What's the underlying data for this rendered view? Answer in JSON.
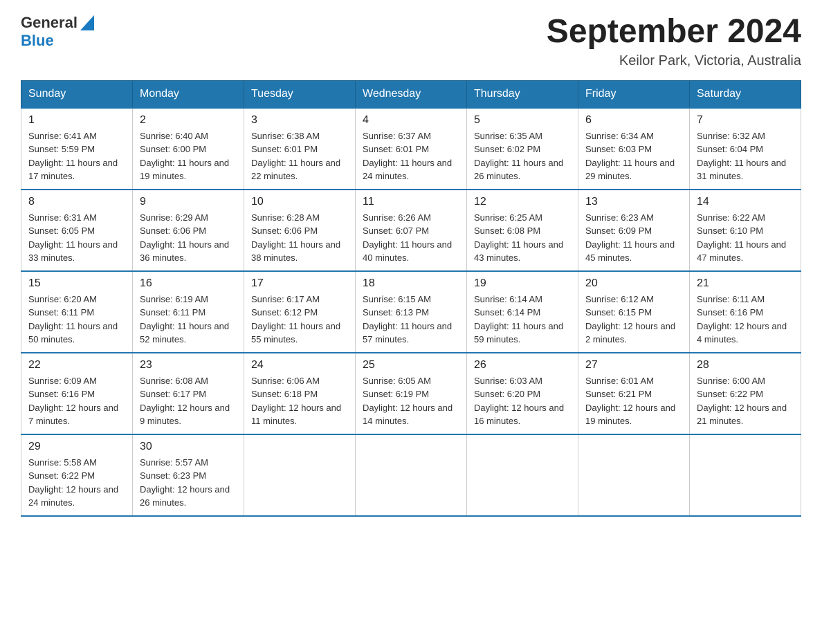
{
  "logo": {
    "text_general": "General",
    "text_blue": "Blue",
    "triangle": "▶"
  },
  "title": "September 2024",
  "subtitle": "Keilor Park, Victoria, Australia",
  "days_of_week": [
    "Sunday",
    "Monday",
    "Tuesday",
    "Wednesday",
    "Thursday",
    "Friday",
    "Saturday"
  ],
  "weeks": [
    [
      {
        "day": "1",
        "sunrise": "6:41 AM",
        "sunset": "5:59 PM",
        "daylight": "11 hours and 17 minutes."
      },
      {
        "day": "2",
        "sunrise": "6:40 AM",
        "sunset": "6:00 PM",
        "daylight": "11 hours and 19 minutes."
      },
      {
        "day": "3",
        "sunrise": "6:38 AM",
        "sunset": "6:01 PM",
        "daylight": "11 hours and 22 minutes."
      },
      {
        "day": "4",
        "sunrise": "6:37 AM",
        "sunset": "6:01 PM",
        "daylight": "11 hours and 24 minutes."
      },
      {
        "day": "5",
        "sunrise": "6:35 AM",
        "sunset": "6:02 PM",
        "daylight": "11 hours and 26 minutes."
      },
      {
        "day": "6",
        "sunrise": "6:34 AM",
        "sunset": "6:03 PM",
        "daylight": "11 hours and 29 minutes."
      },
      {
        "day": "7",
        "sunrise": "6:32 AM",
        "sunset": "6:04 PM",
        "daylight": "11 hours and 31 minutes."
      }
    ],
    [
      {
        "day": "8",
        "sunrise": "6:31 AM",
        "sunset": "6:05 PM",
        "daylight": "11 hours and 33 minutes."
      },
      {
        "day": "9",
        "sunrise": "6:29 AM",
        "sunset": "6:06 PM",
        "daylight": "11 hours and 36 minutes."
      },
      {
        "day": "10",
        "sunrise": "6:28 AM",
        "sunset": "6:06 PM",
        "daylight": "11 hours and 38 minutes."
      },
      {
        "day": "11",
        "sunrise": "6:26 AM",
        "sunset": "6:07 PM",
        "daylight": "11 hours and 40 minutes."
      },
      {
        "day": "12",
        "sunrise": "6:25 AM",
        "sunset": "6:08 PM",
        "daylight": "11 hours and 43 minutes."
      },
      {
        "day": "13",
        "sunrise": "6:23 AM",
        "sunset": "6:09 PM",
        "daylight": "11 hours and 45 minutes."
      },
      {
        "day": "14",
        "sunrise": "6:22 AM",
        "sunset": "6:10 PM",
        "daylight": "11 hours and 47 minutes."
      }
    ],
    [
      {
        "day": "15",
        "sunrise": "6:20 AM",
        "sunset": "6:11 PM",
        "daylight": "11 hours and 50 minutes."
      },
      {
        "day": "16",
        "sunrise": "6:19 AM",
        "sunset": "6:11 PM",
        "daylight": "11 hours and 52 minutes."
      },
      {
        "day": "17",
        "sunrise": "6:17 AM",
        "sunset": "6:12 PM",
        "daylight": "11 hours and 55 minutes."
      },
      {
        "day": "18",
        "sunrise": "6:15 AM",
        "sunset": "6:13 PM",
        "daylight": "11 hours and 57 minutes."
      },
      {
        "day": "19",
        "sunrise": "6:14 AM",
        "sunset": "6:14 PM",
        "daylight": "11 hours and 59 minutes."
      },
      {
        "day": "20",
        "sunrise": "6:12 AM",
        "sunset": "6:15 PM",
        "daylight": "12 hours and 2 minutes."
      },
      {
        "day": "21",
        "sunrise": "6:11 AM",
        "sunset": "6:16 PM",
        "daylight": "12 hours and 4 minutes."
      }
    ],
    [
      {
        "day": "22",
        "sunrise": "6:09 AM",
        "sunset": "6:16 PM",
        "daylight": "12 hours and 7 minutes."
      },
      {
        "day": "23",
        "sunrise": "6:08 AM",
        "sunset": "6:17 PM",
        "daylight": "12 hours and 9 minutes."
      },
      {
        "day": "24",
        "sunrise": "6:06 AM",
        "sunset": "6:18 PM",
        "daylight": "12 hours and 11 minutes."
      },
      {
        "day": "25",
        "sunrise": "6:05 AM",
        "sunset": "6:19 PM",
        "daylight": "12 hours and 14 minutes."
      },
      {
        "day": "26",
        "sunrise": "6:03 AM",
        "sunset": "6:20 PM",
        "daylight": "12 hours and 16 minutes."
      },
      {
        "day": "27",
        "sunrise": "6:01 AM",
        "sunset": "6:21 PM",
        "daylight": "12 hours and 19 minutes."
      },
      {
        "day": "28",
        "sunrise": "6:00 AM",
        "sunset": "6:22 PM",
        "daylight": "12 hours and 21 minutes."
      }
    ],
    [
      {
        "day": "29",
        "sunrise": "5:58 AM",
        "sunset": "6:22 PM",
        "daylight": "12 hours and 24 minutes."
      },
      {
        "day": "30",
        "sunrise": "5:57 AM",
        "sunset": "6:23 PM",
        "daylight": "12 hours and 26 minutes."
      },
      null,
      null,
      null,
      null,
      null
    ]
  ],
  "labels": {
    "sunrise": "Sunrise:",
    "sunset": "Sunset:",
    "daylight": "Daylight:"
  }
}
